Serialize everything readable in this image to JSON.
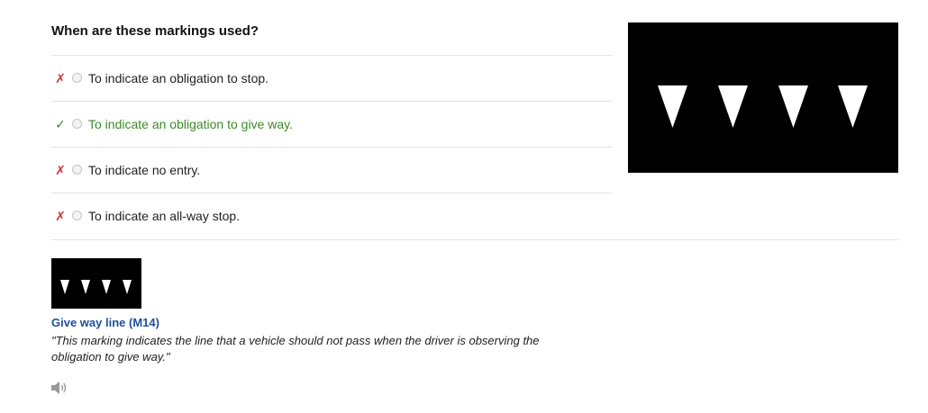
{
  "question": "When are these markings used?",
  "options": [
    {
      "label": "To indicate an obligation to stop.",
      "mark": "✗",
      "status": "wrong"
    },
    {
      "label": "To indicate an obligation to give way.",
      "mark": "✓",
      "status": "correct"
    },
    {
      "label": "To indicate no entry.",
      "mark": "✗",
      "status": "wrong"
    },
    {
      "label": "To indicate an all-way stop.",
      "mark": "✗",
      "status": "wrong"
    }
  ],
  "explanation": {
    "title": "Give way line (M14)",
    "text": "\"This marking indicates the line that a vehicle should not pass when the driver is observing the obligation to give way.\""
  },
  "icons": {
    "audio": "speaker-icon",
    "wrong": "cross-icon",
    "correct": "check-icon"
  },
  "colors": {
    "wrong": "#d83030",
    "correct": "#3d8a2a",
    "link": "#1f4e9c",
    "sign_background": "#000000",
    "sign_marking": "#ffffff"
  }
}
